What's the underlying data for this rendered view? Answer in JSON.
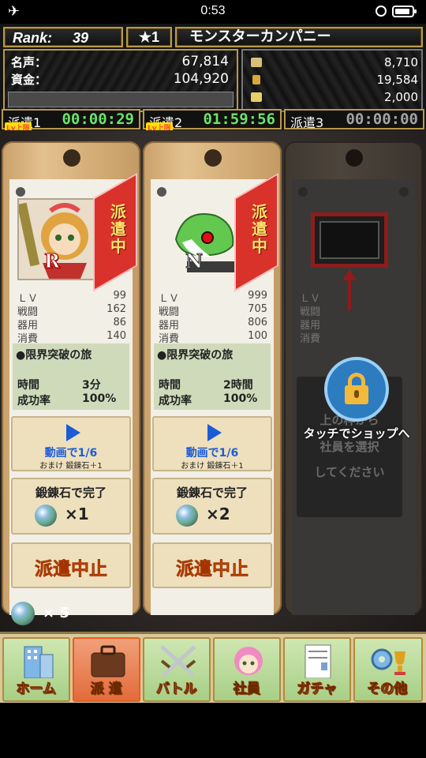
{
  "status_bar": {
    "time": "0:53"
  },
  "header": {
    "rank_label": "Rank:",
    "rank_value": "39",
    "stars": "★1",
    "company_name": "モンスターカンパニー",
    "fame_label": "名声：",
    "fame_value": "67,814",
    "funds_label": "資金：",
    "funds_value": "104,920",
    "resources": [
      {
        "icon": "ore-icon",
        "value": "8,710"
      },
      {
        "icon": "potion-icon",
        "value": "19,584"
      },
      {
        "icon": "ticket-icon",
        "value": "2,000"
      }
    ],
    "timers": [
      {
        "label": "派遣1",
        "value": "00:00:29",
        "cap": "Lv上限"
      },
      {
        "label": "派遣2",
        "value": "01:59:56",
        "cap": "Lv上限"
      },
      {
        "label": "派遣3",
        "value": "00:00:00"
      }
    ]
  },
  "cards": [
    {
      "rarity": "R",
      "status": "派遣中",
      "stats": [
        {
          "k": "ＬＶ",
          "v": "99"
        },
        {
          "k": "戦闘",
          "v": "162"
        },
        {
          "k": "器用",
          "v": "86"
        },
        {
          "k": "消費",
          "v": "140"
        }
      ],
      "journey_title": "●限界突破の旅",
      "time_label": "時間",
      "time_value": "3分",
      "rate_label": "成功率",
      "rate_value": "100%",
      "video_label": "動画で1/6",
      "video_bonus": "おまけ 鍛錬石＋1",
      "finish_label": "鍛錬石で完了",
      "finish_count": "×1",
      "stop_label": "派遣中止"
    },
    {
      "rarity": "N",
      "status": "派遣中",
      "stats": [
        {
          "k": "ＬＶ",
          "v": "999"
        },
        {
          "k": "戦闘",
          "v": "705"
        },
        {
          "k": "器用",
          "v": "806"
        },
        {
          "k": "消費",
          "v": "100"
        }
      ],
      "journey_title": "●限界突破の旅",
      "time_label": "時間",
      "time_value": "2時間",
      "rate_label": "成功率",
      "rate_value": "100%",
      "video_label": "動画で1/6",
      "video_bonus": "おまけ 鍛錬石＋1",
      "finish_label": "鍛錬石で完了",
      "finish_count": "×2",
      "stop_label": "派遣中止"
    }
  ],
  "locked_card": {
    "stats": [
      "ＬＶ",
      "戦闘",
      "器用",
      "消費"
    ],
    "select_lines": [
      "上の枠から",
      "社員を選択",
      "してください"
    ],
    "shop_prompt": "タッチでショップへ"
  },
  "gem_counter": "× 5",
  "tabs": [
    {
      "label": "ホーム",
      "icon": "building-icon",
      "active": false
    },
    {
      "label": "派 遣",
      "icon": "briefcase-icon",
      "active": true
    },
    {
      "label": "バトル",
      "icon": "crossed-swords-icon",
      "active": false
    },
    {
      "label": "社員",
      "icon": "employee-icon",
      "active": false
    },
    {
      "label": "ガチャ",
      "icon": "gacha-icon",
      "active": false
    },
    {
      "label": "その他",
      "icon": "gear-trophy-icon",
      "active": false
    }
  ]
}
